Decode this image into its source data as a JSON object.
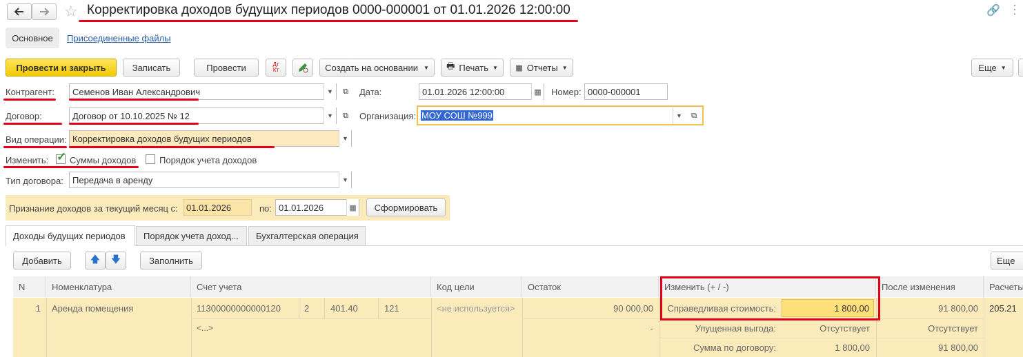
{
  "title": "Корректировка доходов будущих периодов 0000-000001 от 01.01.2026 12:00:00",
  "nav": {
    "main_tab": "Основное",
    "files_link": "Присоединенные файлы"
  },
  "toolbar": {
    "post_close": "Провести и закрыть",
    "save": "Записать",
    "post": "Провести",
    "dtkt": "Дт Кт",
    "create_based": "Создать на основании",
    "print": "Печать",
    "reports": "Отчеты",
    "more": "Еще"
  },
  "form": {
    "counterparty_label": "Контрагент:",
    "counterparty_value": "Семенов Иван Александрович",
    "contract_label": "Договор:",
    "contract_value": "Договор от 10.10.2025 № 12",
    "operation_label": "Вид операции:",
    "operation_value": "Корректировка доходов будущих периодов",
    "change_label": "Изменить:",
    "change_sums": "Суммы доходов",
    "change_sums_checked": true,
    "change_order": "Порядок учета доходов",
    "change_order_checked": false,
    "contract_type_label": "Тип договора:",
    "contract_type_value": "Передача в аренду",
    "date_label": "Дата:",
    "date_value": "01.01.2026 12:00:00",
    "number_label": "Номер:",
    "number_value": "0000-000001",
    "org_label": "Организация:",
    "org_value": "МОУ СОШ №999"
  },
  "recognition": {
    "label": "Признание доходов за текущий месяц с:",
    "from": "01.01.2026",
    "to_label": "по:",
    "to": "01.01.2026",
    "generate": "Сформировать"
  },
  "tabs": [
    "Доходы будущих периодов",
    "Порядок учета доход...",
    "Бухгалтерская операция"
  ],
  "table_toolbar": {
    "add": "Добавить",
    "fill": "Заполнить",
    "more": "Еще"
  },
  "table": {
    "headers": [
      "N",
      "Номенклатура",
      "Счет учета",
      "Код цели",
      "Остаток",
      "Изменить (+ / -)",
      "После изменения",
      "Расчеты"
    ],
    "row": {
      "n": "1",
      "item": "Аренда помещения",
      "account": "11300000000000120",
      "acc2": "2",
      "acc3": "401.40",
      "acc4": "121",
      "acc_more": "<...>",
      "goal_code": "<не используется>",
      "balance": "90 000,00",
      "balance2": "-",
      "fair_value_label": "Справедливая стоимость:",
      "fair_value": "1 800,00",
      "lost_profit_label": "Упущенная выгода:",
      "lost_profit": "Отсутствует",
      "contract_sum_label": "Сумма по договору:",
      "contract_sum": "1 800,00",
      "after_1": "91 800,00",
      "after_2": "Отсутствует",
      "after_3": "91 800,00",
      "settlements": "205.21"
    }
  },
  "colors": {
    "accent_red": "#e3001b",
    "highlight_yellow": "#fbeaba",
    "primary_yellow": "#f5c900"
  }
}
